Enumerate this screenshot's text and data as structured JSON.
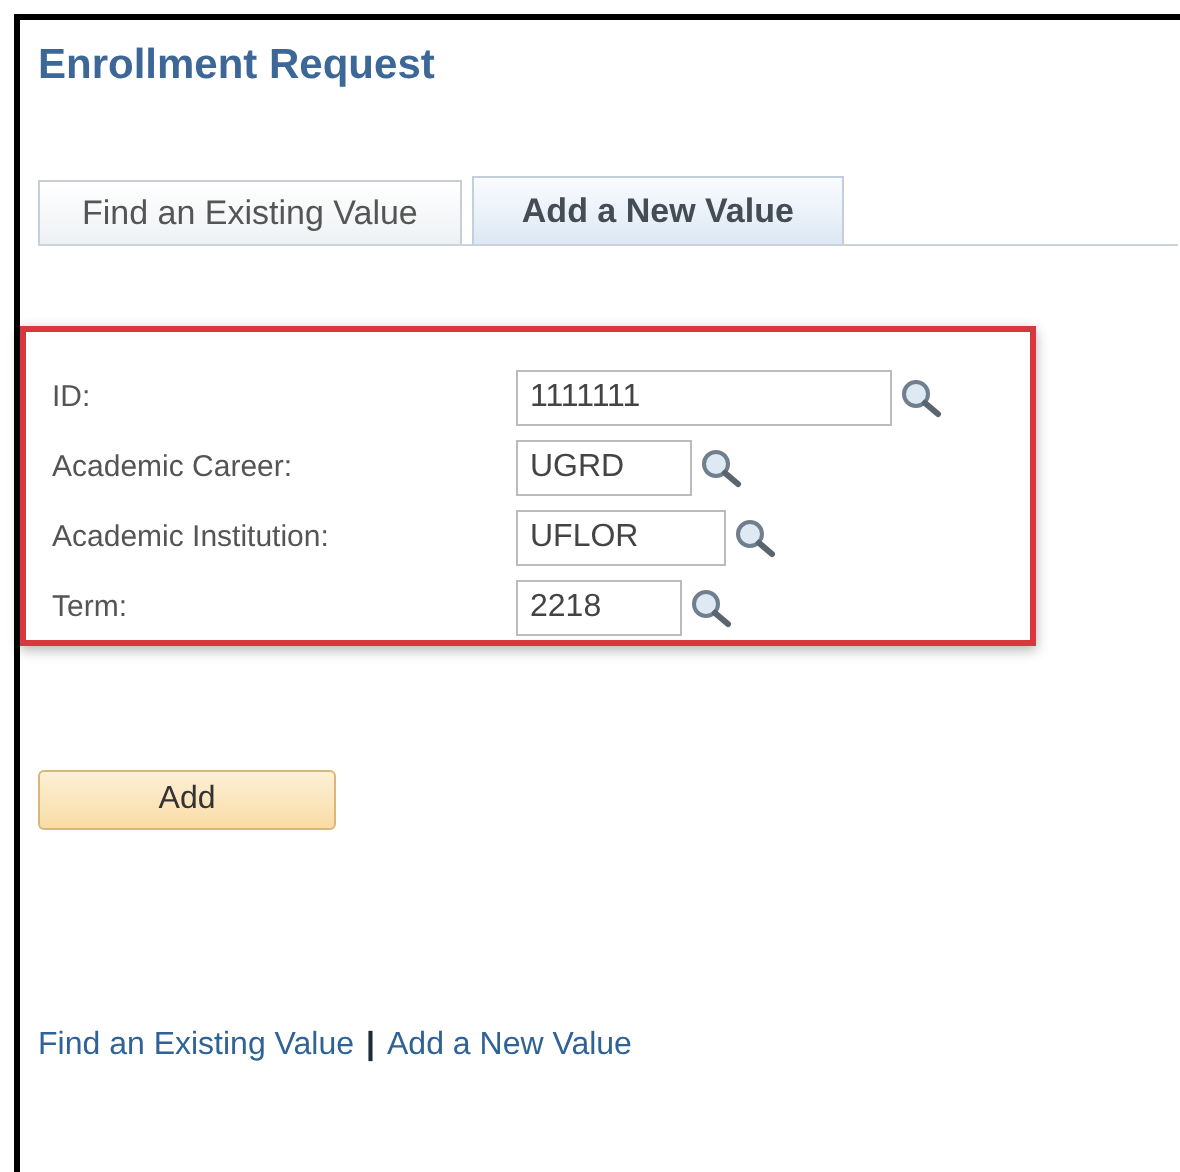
{
  "page_title": "Enrollment Request",
  "tabs": [
    {
      "label": "Find an Existing Value",
      "selected": false
    },
    {
      "label": "Add a New Value",
      "selected": true
    }
  ],
  "fields": [
    {
      "label": "ID:",
      "value": "1111111"
    },
    {
      "label": "Academic Career:",
      "value": "UGRD"
    },
    {
      "label": "Academic Institution:",
      "value": "UFLOR"
    },
    {
      "label": "Term:",
      "value": "2218"
    }
  ],
  "add_button": "Add",
  "bottom_links": [
    {
      "label": "Find an Existing Value"
    },
    {
      "label": "Add a New Value"
    }
  ],
  "link_separator": "|"
}
